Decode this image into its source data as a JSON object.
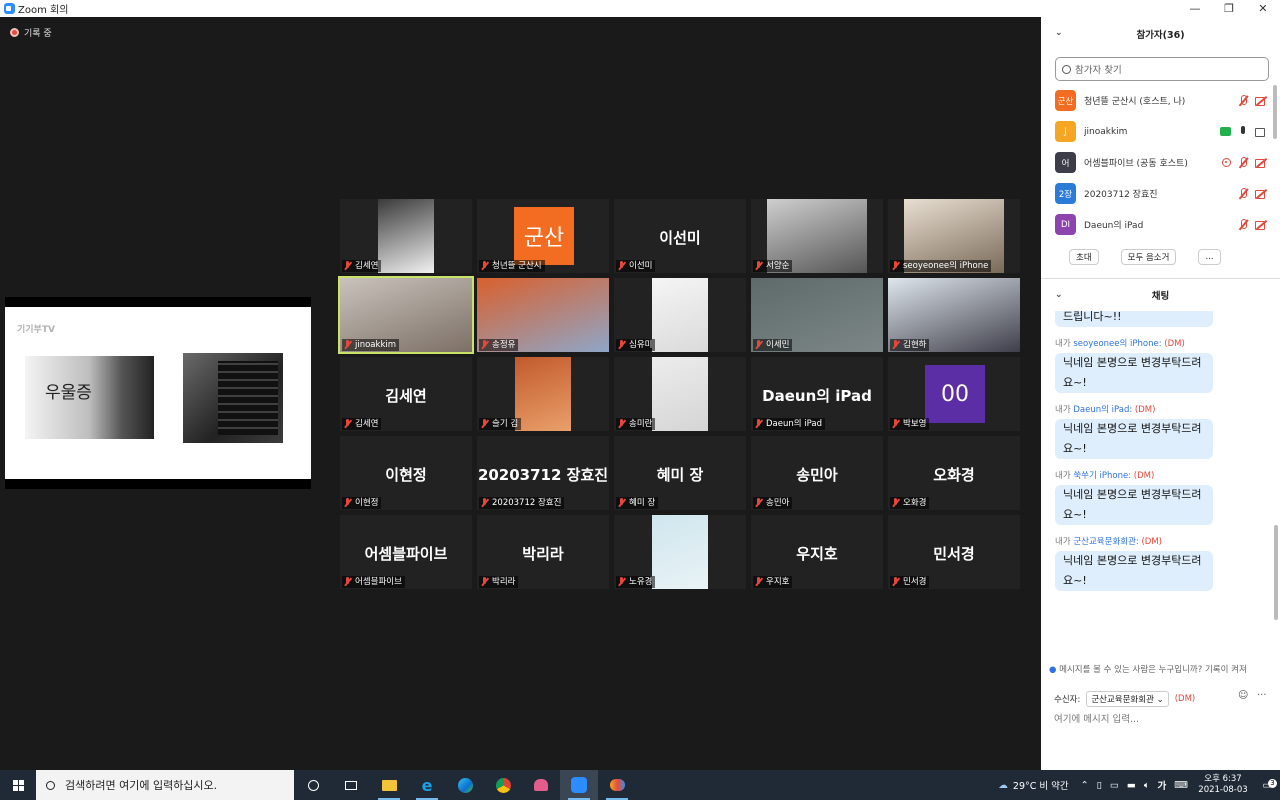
{
  "window": {
    "title": "Zoom 회의",
    "minimize": "—",
    "maximize": "❐",
    "close": "✕"
  },
  "recording": {
    "label": "기록 중"
  },
  "shared_slide": {
    "brand": "기기부TV",
    "caption": "우울증"
  },
  "tiles": [
    {
      "id": "t1",
      "label": "김세연",
      "kind": "video",
      "colors": [
        "#3a3a3a",
        "#f2f2f2"
      ]
    },
    {
      "id": "t2",
      "label": "청년뜰 군산시",
      "kind": "avatar",
      "avatar_text": "군산",
      "avatar_color": "#f26d21"
    },
    {
      "id": "t3",
      "label": "이선미",
      "kind": "name",
      "big": "이선미"
    },
    {
      "id": "t4",
      "label": "서양순",
      "kind": "video",
      "colors": [
        "#cfcfcf",
        "#555"
      ]
    },
    {
      "id": "t5",
      "label": "seoyeonee의 iPhone",
      "kind": "video",
      "colors": [
        "#e8dfd2",
        "#7a6a58"
      ]
    },
    {
      "id": "t6",
      "label": "jinoakkim",
      "kind": "video",
      "colors": [
        "#c9c3bc",
        "#7c6f66"
      ],
      "active": true
    },
    {
      "id": "t7",
      "label": "송정유",
      "kind": "video",
      "colors": [
        "#d9602d",
        "#8fa6c8"
      ]
    },
    {
      "id": "t8",
      "label": "심유미",
      "kind": "video",
      "colors": [
        "#f5f5f5",
        "#dadada"
      ]
    },
    {
      "id": "t9",
      "label": "이세민",
      "kind": "video",
      "colors": [
        "#5e6a6a",
        "#7c8686"
      ]
    },
    {
      "id": "t10",
      "label": "김현하",
      "kind": "video",
      "colors": [
        "#dfe6ec",
        "#3e3e4a"
      ]
    },
    {
      "id": "t11",
      "label": "김세연",
      "kind": "name",
      "big": "김세연"
    },
    {
      "id": "t12",
      "label": "슬기 김",
      "kind": "video",
      "colors": [
        "#c25a2c",
        "#e9a06b"
      ]
    },
    {
      "id": "t13",
      "label": "송미란",
      "kind": "video",
      "colors": [
        "#ececec",
        "#d5d5d5"
      ]
    },
    {
      "id": "t14",
      "label": "Daeun의 iPad",
      "kind": "name",
      "big": "Daeun의 iPad"
    },
    {
      "id": "t15",
      "label": "박보영",
      "kind": "avatar",
      "avatar_text": "00",
      "avatar_color": "#5b2ea6"
    },
    {
      "id": "t16",
      "label": "이현정",
      "kind": "name",
      "big": "이현정"
    },
    {
      "id": "t17",
      "label": "20203712 장효진",
      "kind": "name",
      "big": "20203712 장효진"
    },
    {
      "id": "t18",
      "label": "혜미 장",
      "kind": "name",
      "big": "혜미 장"
    },
    {
      "id": "t19",
      "label": "송민아",
      "kind": "name",
      "big": "송민아"
    },
    {
      "id": "t20",
      "label": "오화경",
      "kind": "name",
      "big": "오화경"
    },
    {
      "id": "t21",
      "label": "어셈블파이브",
      "kind": "name",
      "big": "어셈블파이브"
    },
    {
      "id": "t22",
      "label": "박리라",
      "kind": "name",
      "big": "박리라"
    },
    {
      "id": "t23",
      "label": "노유경",
      "kind": "video",
      "colors": [
        "#cfe6ee",
        "#e9f3f6"
      ]
    },
    {
      "id": "t24",
      "label": "우지호",
      "kind": "name",
      "big": "우지호"
    },
    {
      "id": "t25",
      "label": "민서경",
      "kind": "name",
      "big": "민서경"
    }
  ],
  "participants_panel": {
    "title": "참가자(36)",
    "search_placeholder": "참가자 찾기",
    "items": [
      {
        "avatar": "군산",
        "color": "#f26d21",
        "name": "청년뜰 군산시 (호스트, 나)",
        "state": "muted"
      },
      {
        "avatar": "J",
        "color": "#f5a623",
        "name": "jinoakkim",
        "state": "active"
      },
      {
        "avatar": "어",
        "color": "#3d3d4a",
        "name": "어셈블파이브 (공동 호스트)",
        "state": "recording"
      },
      {
        "avatar": "2장",
        "color": "#2b7bd8",
        "name": "20203712 장효진",
        "state": "muted"
      },
      {
        "avatar": "DI",
        "color": "#8e44ad",
        "name": "Daeun의 iPad",
        "state": "muted"
      }
    ],
    "invite": "초대",
    "mute_all": "모두 음소거",
    "more": "..."
  },
  "chat_panel": {
    "title": "채팅",
    "partial_message": "드립니다~!!",
    "messages": [
      {
        "from": "내가",
        "to": "seoyeonee의 iPhone:",
        "dm": "(DM)",
        "text": "닉네임 본명으로 변경부탁드려요~!"
      },
      {
        "from": "내가",
        "to": "Daeun의 iPad:",
        "dm": "(DM)",
        "text": "닉네임 본명으로 변경부탁드려요~!"
      },
      {
        "from": "내가",
        "to": "쑥쑤기 iPhone:",
        "dm": "(DM)",
        "text": "닉네임 본명으로 변경부탁드려요~!"
      },
      {
        "from": "내가",
        "to": "군산교육문화회관:",
        "dm": "(DM)",
        "text": "닉네임 본명으로 변경부탁드려요~!"
      }
    ],
    "notice": "메시지를 볼 수 있는 사람은 누구입니까? 기록이 켜져",
    "recipient_label": "수신자:",
    "recipient_value": "군산교육문화회관",
    "recipient_dm": "(DM)",
    "input_placeholder": "여기에 메시지 입력..."
  },
  "taskbar": {
    "search_placeholder": "검색하려면 여기에 입력하십시오.",
    "weather": "29°C 비 약간",
    "ime": "가",
    "time": "오후 6:37",
    "date": "2021-08-03",
    "notif_count": "3"
  }
}
